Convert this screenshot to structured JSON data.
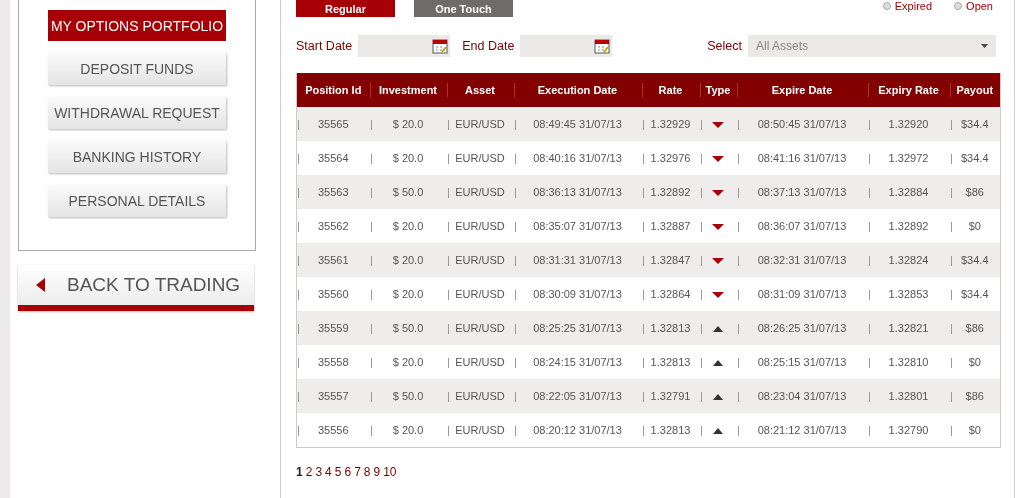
{
  "sidebar": {
    "items": [
      {
        "label": "MY OPTIONS PORTFOLIO",
        "selected": true
      },
      {
        "label": "DEPOSIT FUNDS",
        "selected": false
      },
      {
        "label": "WITHDRAWAL REQUEST",
        "selected": false
      },
      {
        "label": "BANKING HISTORY",
        "selected": false
      },
      {
        "label": "PERSONAL DETAILS",
        "selected": false
      }
    ],
    "back_button": "BACK TO TRADING"
  },
  "option_tabs": [
    {
      "label": "Regular",
      "selected": true
    },
    {
      "label": "One Touch",
      "selected": false
    }
  ],
  "status_radios": [
    {
      "label": "Expired",
      "selected": false
    },
    {
      "label": "Open",
      "selected": false
    }
  ],
  "filters": {
    "start_date_label": "Start Date",
    "end_date_label": "End Date",
    "select_label": "Select",
    "asset_select": "All Assets"
  },
  "table": {
    "columns": [
      "Position Id",
      "Investment",
      "Asset",
      "Execution Date",
      "Rate",
      "Type",
      "Expire Date",
      "Expiry Rate",
      "Payout"
    ],
    "rows": [
      {
        "position_id": "35565",
        "investment": "$ 20.0",
        "asset": "EUR/USD",
        "execution_date": "08:49:45 31/07/13",
        "rate": "1.32929",
        "kind": "down",
        "expire_date": "08:50:45 31/07/13",
        "expiry_rate": "1.32920",
        "payout": "$34.4"
      },
      {
        "position_id": "35564",
        "investment": "$ 20.0",
        "asset": "EUR/USD",
        "execution_date": "08:40:16 31/07/13",
        "rate": "1.32976",
        "kind": "down",
        "expire_date": "08:41:16 31/07/13",
        "expiry_rate": "1.32972",
        "payout": "$34.4"
      },
      {
        "position_id": "35563",
        "investment": "$ 50.0",
        "asset": "EUR/USD",
        "execution_date": "08:36:13 31/07/13",
        "rate": "1.32892",
        "kind": "down",
        "expire_date": "08:37:13 31/07/13",
        "expiry_rate": "1.32884",
        "payout": "$86"
      },
      {
        "position_id": "35562",
        "investment": "$ 20.0",
        "asset": "EUR/USD",
        "execution_date": "08:35:07 31/07/13",
        "rate": "1.32887",
        "kind": "down",
        "expire_date": "08:36:07 31/07/13",
        "expiry_rate": "1.32892",
        "payout": "$0"
      },
      {
        "position_id": "35561",
        "investment": "$ 20.0",
        "asset": "EUR/USD",
        "execution_date": "08:31:31 31/07/13",
        "rate": "1.32847",
        "kind": "down",
        "expire_date": "08:32:31 31/07/13",
        "expiry_rate": "1.32824",
        "payout": "$34.4"
      },
      {
        "position_id": "35560",
        "investment": "$ 20.0",
        "asset": "EUR/USD",
        "execution_date": "08:30:09 31/07/13",
        "rate": "1.32864",
        "kind": "down",
        "expire_date": "08:31:09 31/07/13",
        "expiry_rate": "1.32853",
        "payout": "$34.4"
      },
      {
        "position_id": "35559",
        "investment": "$ 50.0",
        "asset": "EUR/USD",
        "execution_date": "08:25:25 31/07/13",
        "rate": "1.32813",
        "kind": "up",
        "expire_date": "08:26:25 31/07/13",
        "expiry_rate": "1.32821",
        "payout": "$86"
      },
      {
        "position_id": "35558",
        "investment": "$ 20.0",
        "asset": "EUR/USD",
        "execution_date": "08:24:15 31/07/13",
        "rate": "1.32813",
        "kind": "up",
        "expire_date": "08:25:15 31/07/13",
        "expiry_rate": "1.32810",
        "payout": "$0"
      },
      {
        "position_id": "35557",
        "investment": "$ 50.0",
        "asset": "EUR/USD",
        "execution_date": "08:22:05 31/07/13",
        "rate": "1.32791",
        "kind": "up",
        "expire_date": "08:23:04 31/07/13",
        "expiry_rate": "1.32801",
        "payout": "$86"
      },
      {
        "position_id": "35556",
        "investment": "$ 20.0",
        "asset": "EUR/USD",
        "execution_date": "08:20:12 31/07/13",
        "rate": "1.32813",
        "kind": "up",
        "expire_date": "08:21:12 31/07/13",
        "expiry_rate": "1.32790",
        "payout": "$0"
      }
    ]
  },
  "pagination": [
    {
      "label": "1",
      "selected": true
    },
    {
      "label": "2",
      "selected": false
    },
    {
      "label": "3",
      "selected": false
    },
    {
      "label": "4",
      "selected": false
    },
    {
      "label": "5",
      "selected": false
    },
    {
      "label": "6",
      "selected": false
    },
    {
      "label": "7",
      "selected": false
    },
    {
      "label": "8",
      "selected": false
    },
    {
      "label": "9",
      "selected": false
    },
    {
      "label": "10",
      "selected": false
    }
  ]
}
